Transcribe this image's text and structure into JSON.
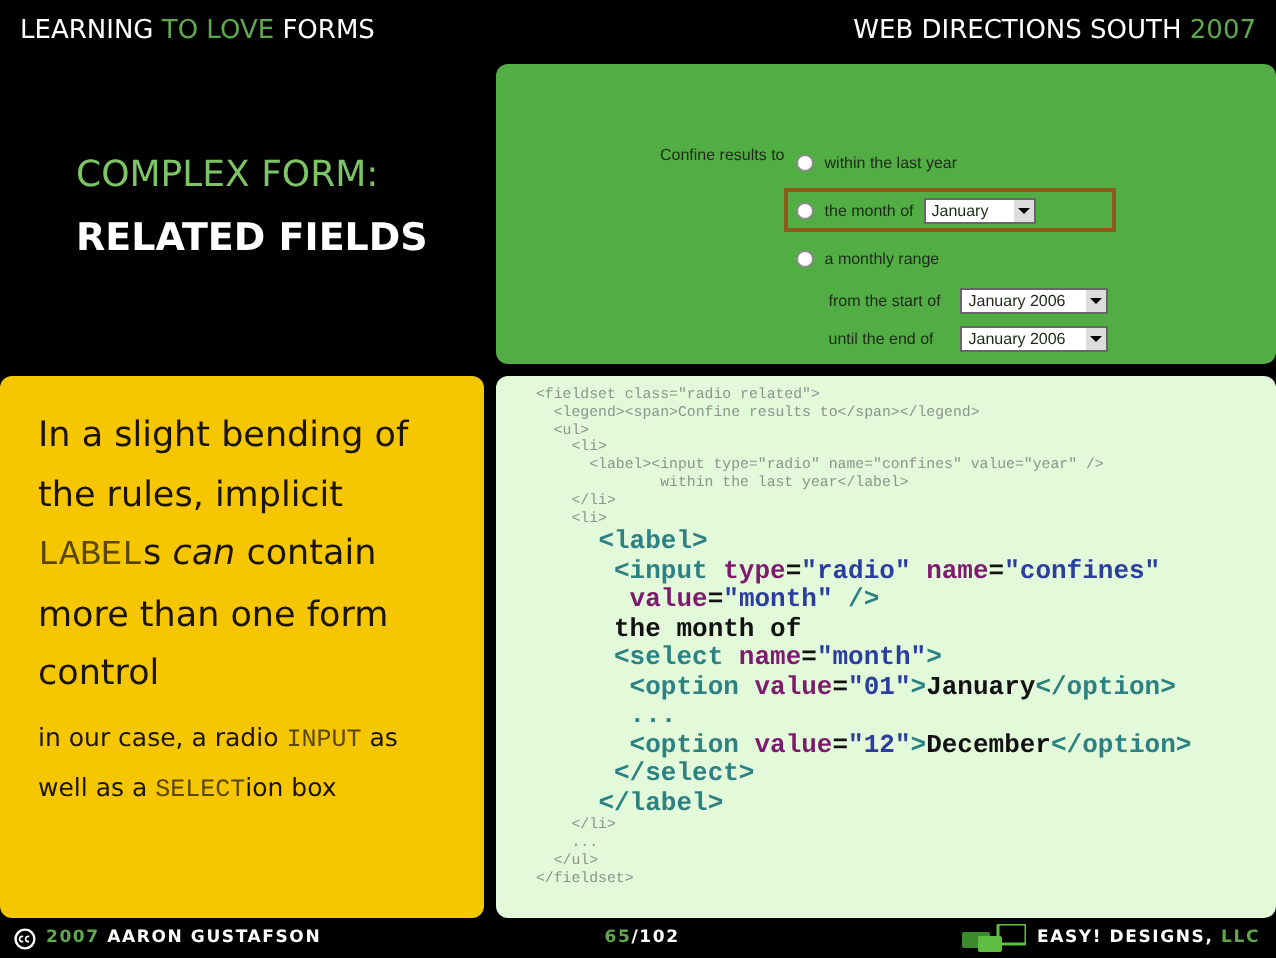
{
  "header": {
    "left": [
      {
        "text": "LEARNING ",
        "accent": false
      },
      {
        "text": "TO LOVE ",
        "accent": true
      },
      {
        "text": "FORMS",
        "accent": false
      }
    ],
    "right": [
      {
        "text": "WEB DIRECTIONS SOUTH ",
        "accent": false
      },
      {
        "text": "2007",
        "accent": true
      }
    ]
  },
  "slide_title": {
    "kicker": "COMPLEX FORM:",
    "title": "RELATED FIELDS"
  },
  "form_example": {
    "legend": "Confine results to",
    "options": [
      {
        "label": "within the last year",
        "checked": false,
        "highlighted": false
      },
      {
        "label": "the month of",
        "checked": false,
        "highlighted": true,
        "select": "January"
      },
      {
        "label": "a monthly range",
        "checked": false,
        "highlighted": false,
        "sub_fields": [
          {
            "label": "from the start of",
            "select": "January 2006"
          },
          {
            "label": "until the end of",
            "select": "January 2006"
          }
        ]
      }
    ]
  },
  "note": {
    "paragraphs": [
      {
        "kind": "large",
        "segments": [
          {
            "text": "In a slight bending of the rules, implicit ",
            "kind": "plain"
          },
          {
            "text": "LABEL",
            "kind": "mono"
          },
          {
            "text": "s ",
            "kind": "plain"
          },
          {
            "text": "can",
            "kind": "italic"
          },
          {
            "text": " contain more than one form control",
            "kind": "plain"
          }
        ]
      },
      {
        "kind": "small",
        "segments": [
          {
            "text": "in our case, a radio ",
            "kind": "plain"
          },
          {
            "text": "INPUT",
            "kind": "mono"
          },
          {
            "text": " as well as a ",
            "kind": "plain"
          },
          {
            "text": "SELECT",
            "kind": "mono"
          },
          {
            "text": "ion box",
            "kind": "plain"
          }
        ]
      }
    ]
  },
  "code": {
    "lines": [
      {
        "kind": "small",
        "tokens": [
          {
            "text": "<fieldset class=\"radio related\">",
            "kind": "plain"
          }
        ]
      },
      {
        "kind": "small",
        "tokens": [
          {
            "text": "  <legend><span>Confine results to</span></legend>",
            "kind": "plain"
          }
        ]
      },
      {
        "kind": "small",
        "tokens": [
          {
            "text": "  <ul>",
            "kind": "plain"
          }
        ]
      },
      {
        "kind": "small",
        "tokens": [
          {
            "text": "    <li>",
            "kind": "plain"
          }
        ]
      },
      {
        "kind": "small",
        "tokens": [
          {
            "text": "      <label><input type=\"radio\" name=\"confines\" value=\"year\" />",
            "kind": "plain"
          }
        ]
      },
      {
        "kind": "small",
        "tokens": [
          {
            "text": "              within the last year</label>",
            "kind": "plain"
          }
        ]
      },
      {
        "kind": "small",
        "tokens": [
          {
            "text": "    </li>",
            "kind": "plain"
          }
        ]
      },
      {
        "kind": "small",
        "tokens": [
          {
            "text": "    <li>",
            "kind": "plain"
          }
        ]
      },
      {
        "kind": "large",
        "tokens": [
          {
            "text": "    <label>",
            "kind": "tag"
          }
        ]
      },
      {
        "kind": "large",
        "tokens": [
          {
            "text": "     <input ",
            "kind": "tag"
          },
          {
            "text": "type",
            "kind": "attr"
          },
          {
            "text": "=",
            "kind": "plain"
          },
          {
            "text": "\"radio\"",
            "kind": "value"
          },
          {
            "text": " name",
            "kind": "attr"
          },
          {
            "text": "=",
            "kind": "plain"
          },
          {
            "text": "\"confines\"",
            "kind": "value"
          }
        ]
      },
      {
        "kind": "large",
        "tokens": [
          {
            "text": "      value",
            "kind": "attr"
          },
          {
            "text": "=",
            "kind": "plain"
          },
          {
            "text": "\"month\"",
            "kind": "value"
          },
          {
            "text": " />",
            "kind": "tag"
          }
        ]
      },
      {
        "kind": "large",
        "tokens": [
          {
            "text": "     the month of",
            "kind": "plain"
          }
        ]
      },
      {
        "kind": "large",
        "tokens": [
          {
            "text": "     <select ",
            "kind": "tag"
          },
          {
            "text": "name",
            "kind": "attr"
          },
          {
            "text": "=",
            "kind": "plain"
          },
          {
            "text": "\"month\"",
            "kind": "value"
          },
          {
            "text": ">",
            "kind": "tag"
          }
        ]
      },
      {
        "kind": "large",
        "tokens": [
          {
            "text": "      <option ",
            "kind": "tag"
          },
          {
            "text": "value",
            "kind": "attr"
          },
          {
            "text": "=",
            "kind": "plain"
          },
          {
            "text": "\"01\"",
            "kind": "value"
          },
          {
            "text": ">",
            "kind": "tag"
          },
          {
            "text": "January",
            "kind": "plain"
          },
          {
            "text": "</option>",
            "kind": "tag"
          }
        ]
      },
      {
        "kind": "large",
        "tokens": [
          {
            "text": "      ...",
            "kind": "tag"
          }
        ]
      },
      {
        "kind": "large",
        "tokens": [
          {
            "text": "      <option ",
            "kind": "tag"
          },
          {
            "text": "value",
            "kind": "attr"
          },
          {
            "text": "=",
            "kind": "plain"
          },
          {
            "text": "\"12\"",
            "kind": "value"
          },
          {
            "text": ">",
            "kind": "tag"
          },
          {
            "text": "December",
            "kind": "plain"
          },
          {
            "text": "</option>",
            "kind": "tag"
          }
        ]
      },
      {
        "kind": "large",
        "tokens": [
          {
            "text": "     </select>",
            "kind": "tag"
          }
        ]
      },
      {
        "kind": "large",
        "tokens": [
          {
            "text": "    </label>",
            "kind": "tag"
          }
        ]
      },
      {
        "kind": "small",
        "tokens": [
          {
            "text": "    </li>",
            "kind": "plain"
          }
        ]
      },
      {
        "kind": "small",
        "tokens": [
          {
            "text": "    ...",
            "kind": "plain"
          }
        ]
      },
      {
        "kind": "small",
        "tokens": [
          {
            "text": "  </ul>",
            "kind": "plain"
          }
        ]
      },
      {
        "kind": "small",
        "tokens": [
          {
            "text": "</fieldset>",
            "kind": "plain"
          }
        ]
      }
    ]
  },
  "footer": {
    "left": [
      {
        "text": "2007 ",
        "accent": true
      },
      {
        "text": "AARON GUSTAFSON",
        "accent": false
      }
    ],
    "page": [
      {
        "text": "65",
        "accent": true
      },
      {
        "text": "/102",
        "accent": false
      }
    ],
    "right": [
      {
        "text": "EASY! DESIGNS, ",
        "accent": false
      },
      {
        "text": "LLC",
        "accent": true
      }
    ]
  }
}
